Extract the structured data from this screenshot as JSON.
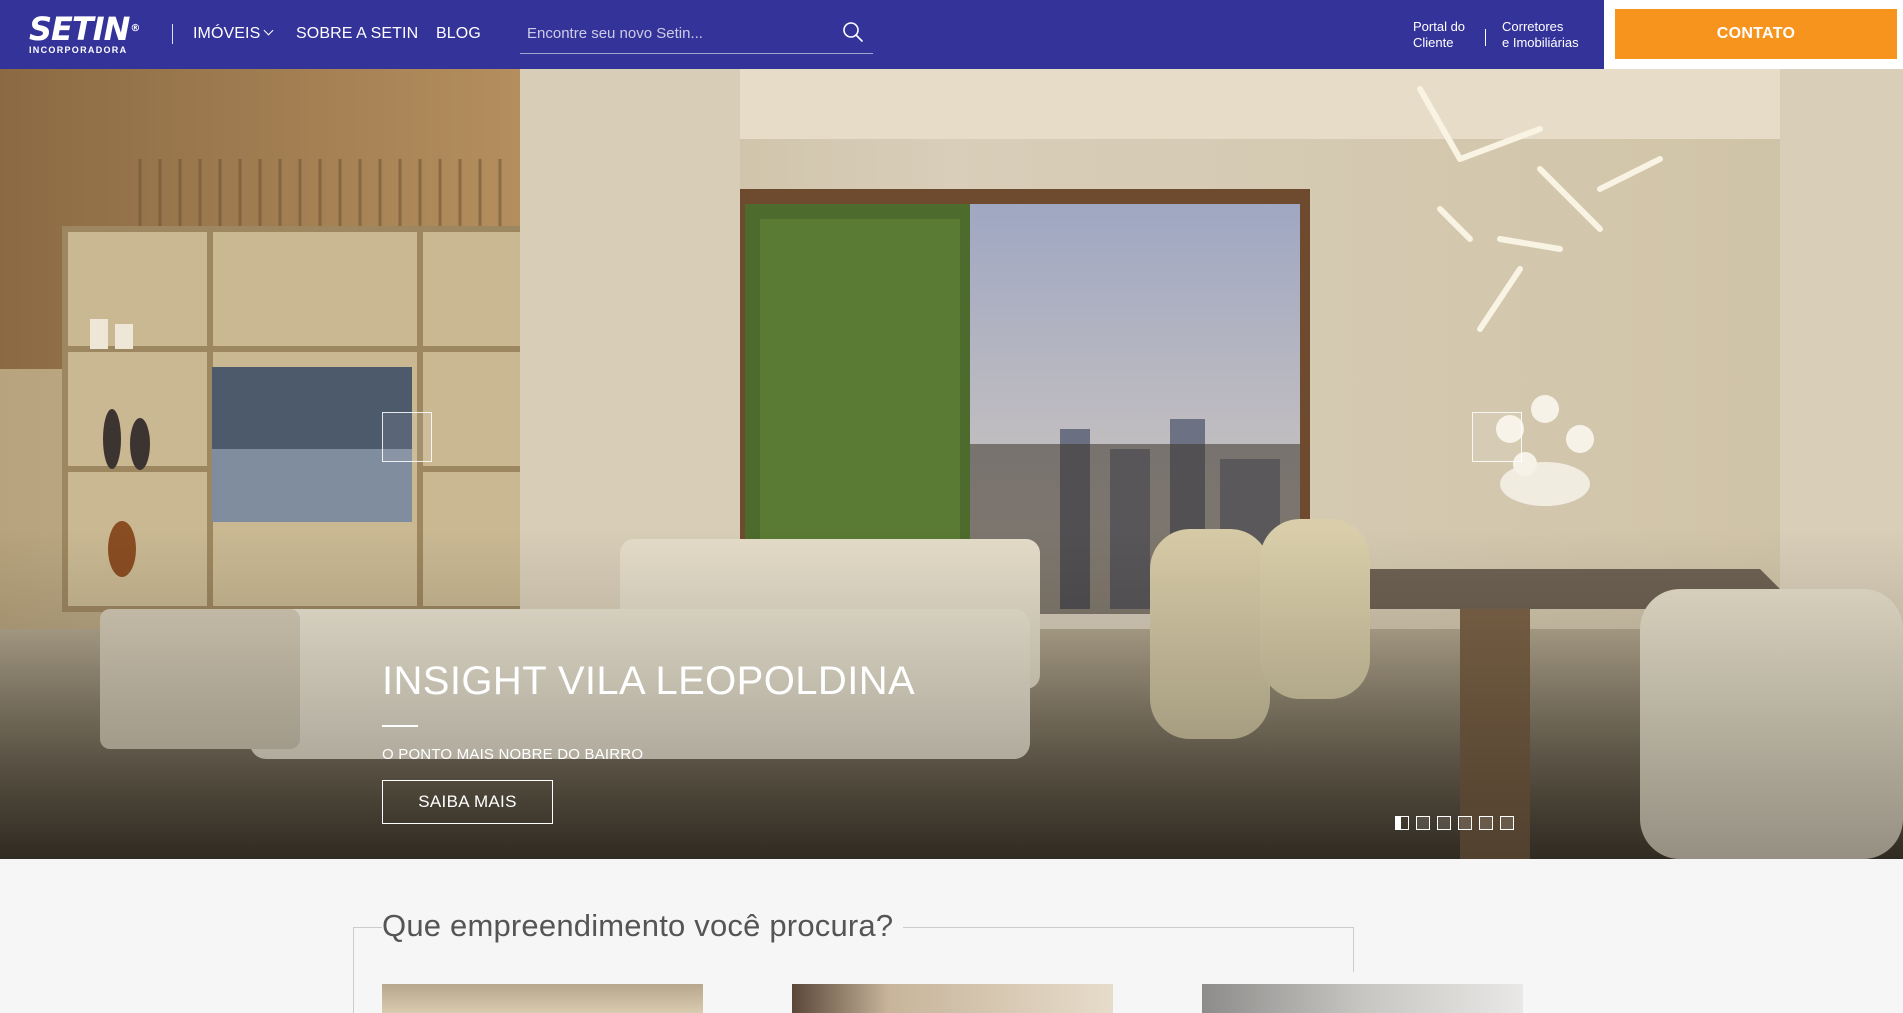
{
  "header": {
    "logo_text": "SETIN",
    "logo_registered": "®",
    "logo_subtitle": "INCORPORADORA",
    "nav": {
      "imoveis": "IMÓVEIS",
      "sobre": "SOBRE A SETIN",
      "blog": "BLOG"
    },
    "search_placeholder": "Encontre seu novo Setin...",
    "portal_cliente": [
      "Portal do",
      "Cliente"
    ],
    "corretores": [
      "Corretores",
      "e Imobiliárias"
    ],
    "contato": "CONTATO",
    "colors": {
      "header_bg": "#34339a",
      "accent": "#f7941d"
    }
  },
  "hero": {
    "title": "INSIGHT VILA LEOPOLDINA",
    "subtitle": "O PONTO MAIS NOBRE DO BAIRRO",
    "button": "SAIBA MAIS",
    "slide_count": 6,
    "active_slide": 1
  },
  "section": {
    "title": "Que empreendimento você procura?"
  }
}
